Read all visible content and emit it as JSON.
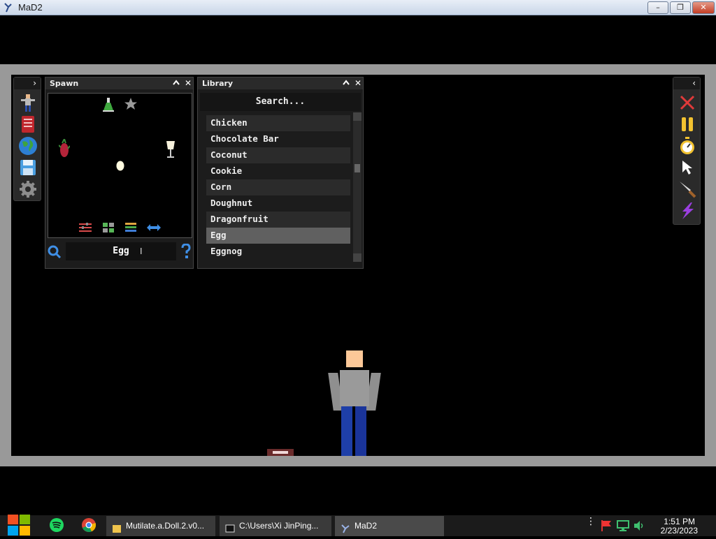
{
  "window": {
    "title": "MaD2",
    "minimize_label": "–",
    "maximize_label": "❐",
    "close_label": "✕"
  },
  "left_strip": {
    "toggle": "›",
    "tools": [
      "ragdoll-icon",
      "book-icon",
      "globe-icon",
      "floppy-disk-icon",
      "gear-icon"
    ]
  },
  "spawn_panel": {
    "title": "Spawn",
    "collapse": "^",
    "close": "✕",
    "selected_name": "Egg",
    "top_icons": [
      "flask-icon",
      "star-icon"
    ],
    "bottom_icons": [
      "sliders-icon",
      "grid-icon",
      "stack-icon",
      "swap-arrows-icon"
    ]
  },
  "library_panel": {
    "title": "Library",
    "collapse": "^",
    "close": "✕",
    "search_placeholder": "Search...",
    "items": [
      "Chicken",
      "Chocolate Bar",
      "Coconut",
      "Cookie",
      "Corn",
      "Doughnut",
      "Dragonfruit",
      "Egg",
      "Eggnog"
    ],
    "selected": "Egg"
  },
  "right_strip": {
    "toggle": "‹",
    "tools": [
      "close-x-icon",
      "pause-icon",
      "stopwatch-icon",
      "cursor-icon",
      "knife-icon",
      "lightning-icon"
    ]
  },
  "taskbar": {
    "tasks": [
      {
        "label": "Mutilate.a.Doll.2.v0..."
      },
      {
        "label": "C:\\Users\\Xi JinPing..."
      },
      {
        "label": "MaD2"
      }
    ],
    "time": "1:51 PM",
    "date": "2/23/2023"
  }
}
